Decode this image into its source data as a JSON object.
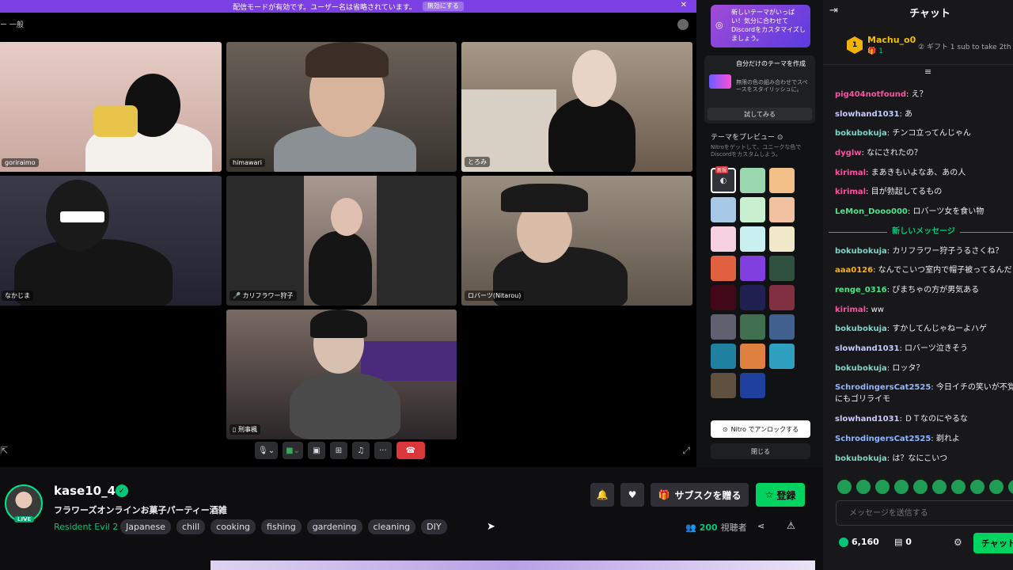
{
  "banner": {
    "text": "配信モードが有効です。ユーザー名は省略されています。",
    "button": "無効にする"
  },
  "channel": "一般",
  "tiles": [
    {
      "label": "goriraimo"
    },
    {
      "label": "himawari"
    },
    {
      "label": "とろみ"
    },
    {
      "label": "なかじま"
    },
    {
      "label": "カリフラワー狩子"
    },
    {
      "label": "ロバーツ(Nitarou)"
    },
    {
      "label": "刑事楓"
    }
  ],
  "theme_panel": {
    "promo": "新しいテーマがいっぱい！気分に合わせてDiscordをカスタマイズしましょう。",
    "custom_title": "自分だけのテーマを作成",
    "custom_desc": "無限の色の組み合わせでスペースをスタイリッシュに。",
    "try_button": "試してみる",
    "preview_title": "テーマをプレビュー",
    "preview_desc": "Nitroをゲットして、ユニークな色でDiscordをカスタムしよう。",
    "new_tag": "新規",
    "nitro_button": "Nitro でアンロックする",
    "close_button": "閉じる"
  },
  "swatch_colors": [
    "#313338",
    "#9ad7b0",
    "#f3c08a",
    "#a8c8e8",
    "#c8f0d0",
    "#f0c0a0",
    "#f4d0e0",
    "#c8f0f0",
    "#f0e8c8",
    "#e06040",
    "#8040e0",
    "#305040",
    "#400818",
    "#202050",
    "#803040",
    "#606070",
    "#407050",
    "#406090",
    "#2080a0",
    "#e08040",
    "#30a0c0",
    "#605040",
    "#2040a0"
  ],
  "streamer": {
    "name": "kase10_4",
    "live": "LIVE",
    "title": "フラワーズオンラインお菓子パーティー酒雑",
    "game": "Resident Evil 2",
    "tags": [
      "Japanese",
      "chill",
      "cooking",
      "fishing",
      "gardening",
      "cleaning",
      "DIY"
    ],
    "gift_label": "サブスクを贈る",
    "sub_label": "登録",
    "viewer_count": "200",
    "viewer_label": "視聴者"
  },
  "chat": {
    "title": "チャット",
    "leader_name": "Machu_o0",
    "leader_rank": "1",
    "leader_count": "1",
    "leader_gift": "ギフト 1 sub to take 2th",
    "messages_before": [
      {
        "user": "pig404notfound",
        "text": ": え？",
        "color": "#ff4fa3"
      },
      {
        "user": "slowhand1031",
        "text": ": あ",
        "color": "#c9c9ff"
      },
      {
        "user": "bokubokuja",
        "text": ": チンコ立ってんじゃん",
        "color": "#7fd4c8"
      },
      {
        "user": "dyglw",
        "text": ": なにされたの？",
        "color": "#ff4fa3"
      },
      {
        "user": "kirimal",
        "text": ": まあきもいよなあ、あの人",
        "color": "#ff4fa3"
      },
      {
        "user": "kirimal",
        "text": ": 目が勃起してるもの",
        "color": "#ff4fa3"
      },
      {
        "user": "LeMon_Dooo000",
        "text": ": ロバーツ女を食い物",
        "color": "#4fe38a"
      }
    ],
    "new_messages_label": "新しいメッセージ",
    "messages_after": [
      {
        "user": "bokubokuja",
        "text": ": カリフラワー狩子うるさくね？",
        "color": "#7fd4c8"
      },
      {
        "user": "aaa0126",
        "text": ": なんでこいつ室内で帽子被ってるんだ",
        "color": "#ffb000"
      },
      {
        "user": "renge_0316",
        "text": ": ぴまちゃの方が男気ある",
        "color": "#4fe38a"
      },
      {
        "user": "kirimal",
        "text": ": ww",
        "color": "#ff4fa3"
      },
      {
        "user": "bokubokuja",
        "text": ": すかしてんじゃねーよハゲ",
        "color": "#7fd4c8"
      },
      {
        "user": "slowhand1031",
        "text": ": ロバーツ泣きそう",
        "color": "#c9c9ff"
      },
      {
        "user": "bokubokuja",
        "text": ": ロッタ？",
        "color": "#7fd4c8"
      },
      {
        "user": "SchrodingersCat2525",
        "text": ": 今日イチの笑いが不覚にもゴリライモ",
        "color": "#8fb6ff"
      },
      {
        "user": "slowhand1031",
        "text": ": ＤＴなのにやるな",
        "color": "#c9c9ff"
      },
      {
        "user": "SchrodingersCat2525",
        "text": ": 剃れよ",
        "color": "#8fb6ff"
      },
      {
        "user": "bokubokuja",
        "text": ": は？なにこいつ",
        "color": "#7fd4c8"
      }
    ],
    "input_placeholder": "メッセージを送信する",
    "points": "6,160",
    "bits": "0",
    "chat_button": "チャット"
  }
}
